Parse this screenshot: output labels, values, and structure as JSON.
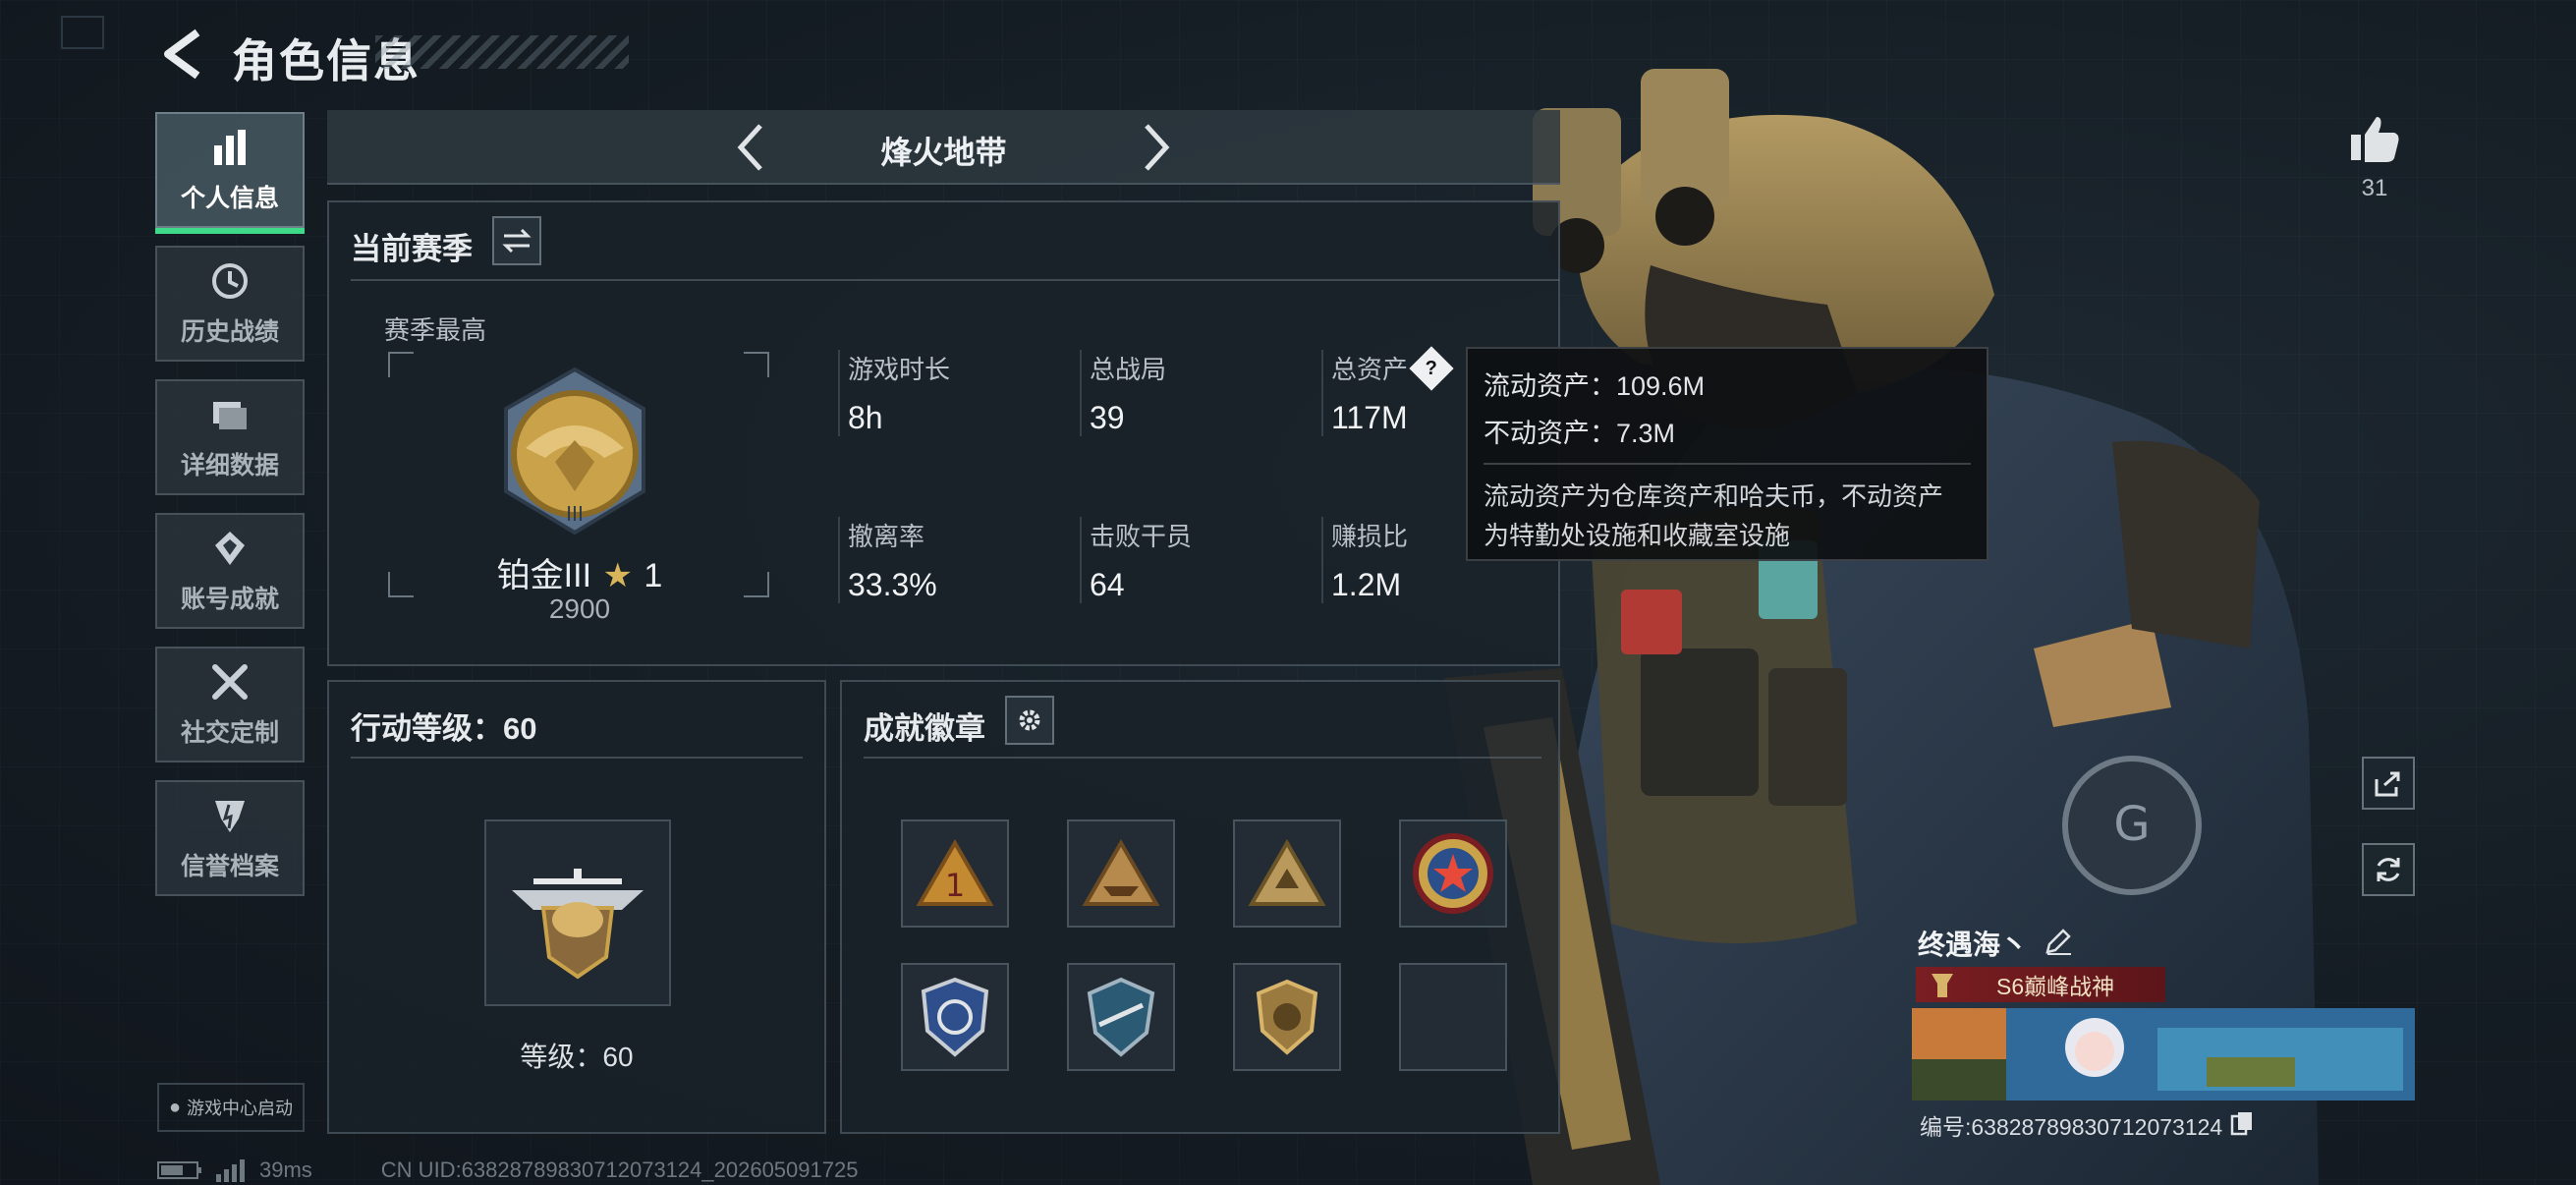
{
  "header": {
    "title": "角色信息"
  },
  "sidebar": {
    "items": [
      {
        "label": "个人信息",
        "icon": "bar-chart-icon",
        "active": true
      },
      {
        "label": "历史战绩",
        "icon": "history-icon"
      },
      {
        "label": "详细数据",
        "icon": "folder-icon"
      },
      {
        "label": "账号成就",
        "icon": "achievement-icon"
      },
      {
        "label": "社交定制",
        "icon": "tools-icon"
      },
      {
        "label": "信誉档案",
        "icon": "reputation-icon"
      }
    ],
    "game_center_label": "游戏中心启动"
  },
  "mode": {
    "title": "烽火地带"
  },
  "season": {
    "header": "当前赛季",
    "best_label": "赛季最高",
    "rank_name": "铂金III",
    "rank_stars": "1",
    "rank_score": "2900",
    "stats": [
      {
        "label": "游戏时长",
        "value": "8h"
      },
      {
        "label": "总战局",
        "value": "39"
      },
      {
        "label": "总资产",
        "value": "117M"
      },
      {
        "label": "撤离率",
        "value": "33.3%"
      },
      {
        "label": "击败干员",
        "value": "64"
      },
      {
        "label": "赚损比",
        "value": "1.2M"
      }
    ]
  },
  "tooltip": {
    "liquid": "流动资产：109.6M",
    "fixed": "不动资产：7.3M",
    "description_line1": "流动资产为仓库资产和哈夫币，不动资产",
    "description_line2": "为特勤处设施和收藏室设施"
  },
  "action_level": {
    "header": "行动等级：60",
    "level_text": "等级：60"
  },
  "badges": {
    "header": "成就徽章",
    "items": [
      "badge-1",
      "badge-2",
      "badge-3",
      "badge-4",
      "badge-5",
      "badge-6",
      "badge-7",
      "badge-empty"
    ]
  },
  "likes": {
    "count": "31"
  },
  "player": {
    "name": "终遇海丶",
    "title": "S6巅峰战神",
    "id_text": "编号:6382878983071207312​4"
  },
  "status_bar": {
    "ping": "39ms",
    "uid": "CN UID:6382878983071207312​4_202605091725"
  },
  "colors": {
    "accent_green": "#3fd98a",
    "gold": "#c9a24a",
    "title_red": "#7a1e22"
  }
}
